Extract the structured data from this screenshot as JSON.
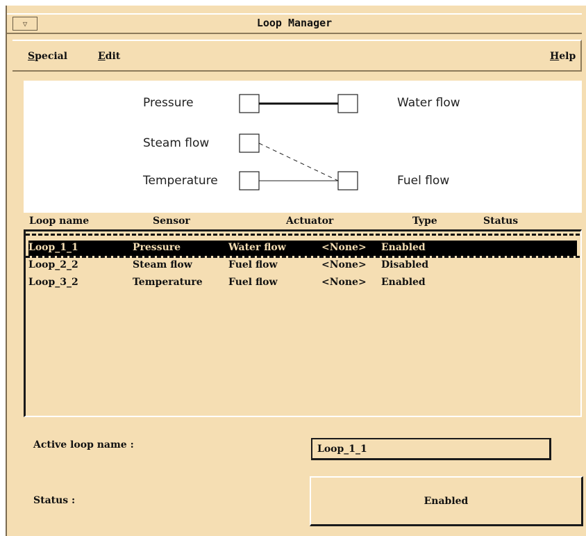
{
  "window": {
    "title": "Loop Manager"
  },
  "menubar": {
    "special": {
      "mnemonic": "S",
      "rest": "pecial"
    },
    "edit": {
      "mnemonic": "E",
      "rest": "dit"
    },
    "help": {
      "mnemonic": "H",
      "rest": "elp"
    }
  },
  "diagram": {
    "sensors": [
      "Pressure",
      "Steam flow",
      "Temperature"
    ],
    "actuators": [
      "Water flow",
      "Fuel flow"
    ],
    "links": [
      {
        "sensor": "Pressure",
        "actuator": "Water flow",
        "style": "bold"
      },
      {
        "sensor": "Steam flow",
        "actuator": "Fuel flow",
        "style": "dashed"
      },
      {
        "sensor": "Temperature",
        "actuator": "Fuel flow",
        "style": "solid"
      }
    ]
  },
  "list": {
    "headers": [
      "Loop name",
      "Sensor",
      "Actuator",
      "Type",
      "Status"
    ],
    "rows": [
      {
        "name": "Loop_1_1",
        "sensor": "Pressure",
        "actuator": "Water flow",
        "type": "<None>",
        "status": "Enabled"
      },
      {
        "name": "Loop_2_2",
        "sensor": "Steam flow",
        "actuator": "Fuel flow",
        "type": "<None>",
        "status": "Disabled"
      },
      {
        "name": "Loop_3_2",
        "sensor": "Temperature",
        "actuator": "Fuel flow",
        "type": "<None>",
        "status": "Enabled"
      }
    ],
    "selected_index": 0
  },
  "active_loop": {
    "label": "Active loop name :",
    "value": "Loop_1_1"
  },
  "status": {
    "label": "Status :",
    "value": "Enabled"
  },
  "colors": {
    "background": "#f5deb3",
    "selection": "#000000",
    "panel": "#ffffff"
  }
}
